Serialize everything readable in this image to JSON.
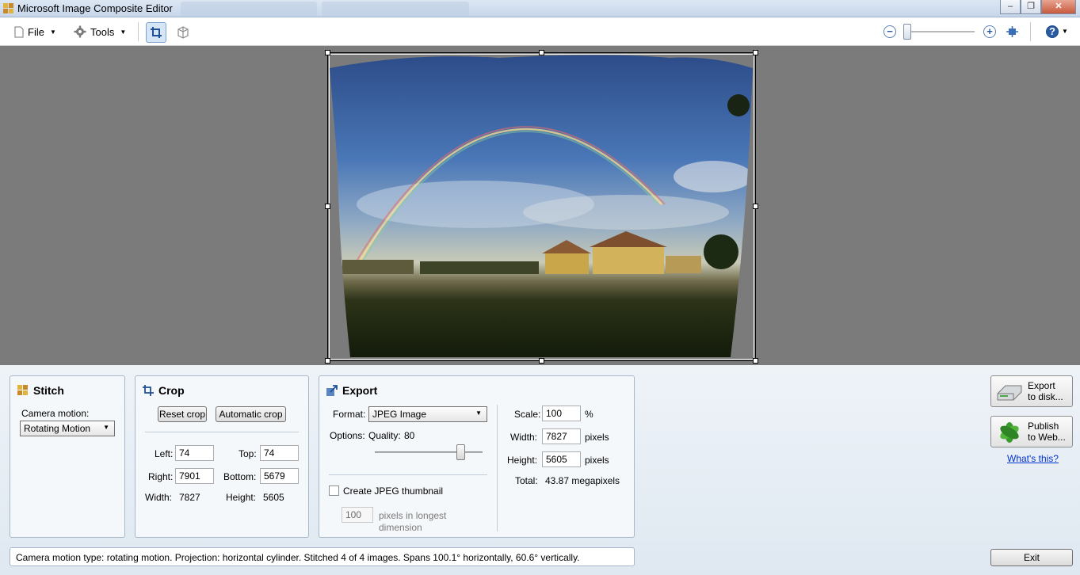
{
  "window": {
    "title": "Microsoft Image Composite Editor",
    "controls": {
      "minimize": "–",
      "restore": "❐",
      "close": "✕"
    }
  },
  "toolbar": {
    "file_label": "File",
    "tools_label": "Tools",
    "zoom_out": "−",
    "zoom_in": "+",
    "help": "?",
    "zoom_level": 0.05
  },
  "stitch": {
    "title": "Stitch",
    "camera_motion_label": "Camera motion:",
    "camera_motion_value": "Rotating Motion"
  },
  "crop": {
    "title": "Crop",
    "reset_label": "Reset crop",
    "auto_label": "Automatic crop",
    "left_label": "Left:",
    "left_value": "74",
    "top_label": "Top:",
    "top_value": "74",
    "right_label": "Right:",
    "right_value": "7901",
    "bottom_label": "Bottom:",
    "bottom_value": "5679",
    "width_label": "Width:",
    "width_value": "7827",
    "height_label": "Height:",
    "height_value": "5605"
  },
  "export": {
    "title": "Export",
    "format_label": "Format:",
    "format_value": "JPEG Image",
    "options_label": "Options:",
    "quality_label": "Quality:",
    "quality_value": "80",
    "quality_fraction": 0.8,
    "thumbnail_label": "Create JPEG thumbnail",
    "thumbnail_checked": false,
    "thumb_size_value": "100",
    "thumb_size_label_1": "pixels in longest",
    "thumb_size_label_2": "dimension",
    "scale_label": "Scale:",
    "scale_value": "100",
    "scale_unit": "%",
    "width_label": "Width:",
    "width_value": "7827",
    "width_unit": "pixels",
    "height_label": "Height:",
    "height_value": "5605",
    "height_unit": "pixels",
    "total_label": "Total:",
    "total_value": "43.87 megapixels"
  },
  "actions": {
    "export_disk_1": "Export",
    "export_disk_2": "to disk...",
    "publish_1": "Publish",
    "publish_2": "to Web...",
    "whats_this": "What's this?",
    "exit": "Exit"
  },
  "status": {
    "text": "Camera motion type: rotating motion. Projection: horizontal cylinder. Stitched 4 of 4 images. Spans 100.1° horizontally, 60.6° vertically."
  },
  "colors": {
    "sky_top": "#2c4e8c",
    "sky_mid": "#5b86c2",
    "ground": "#1b2412",
    "house": "#c9a64a",
    "link": "#0033cc"
  }
}
